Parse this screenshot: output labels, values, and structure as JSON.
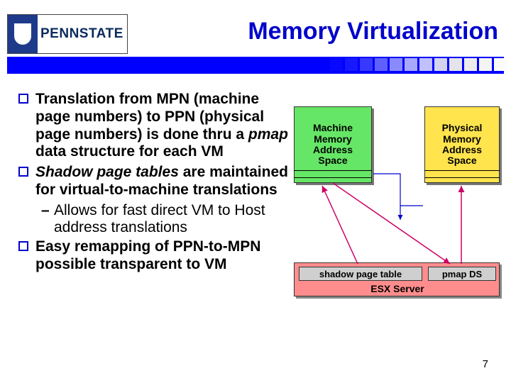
{
  "header": {
    "logo_text": "PENNSTATE",
    "title": "Memory Virtualization"
  },
  "bullets": [
    {
      "pre": "Translation from MPN (machine page numbers) to PPN (physical page numbers) is done thru a ",
      "ital": "pmap",
      "post": " data structure for each VM"
    },
    {
      "pre": "",
      "ital": "Shadow page tables",
      "post": " are maintained for virtual-to-machine translations",
      "sub": "Allows for fast direct VM to Host address translations"
    },
    {
      "pre": "Easy remapping of PPN-to-MPN possible transparent to VM",
      "ital": "",
      "post": ""
    }
  ],
  "diagram": {
    "mmas": "Machine Memory Address Space",
    "pmas": "Physical Memory Address Space",
    "spt": "shadow page table",
    "pmap": "pmap DS",
    "esx": "ESX Server"
  },
  "page": "7"
}
